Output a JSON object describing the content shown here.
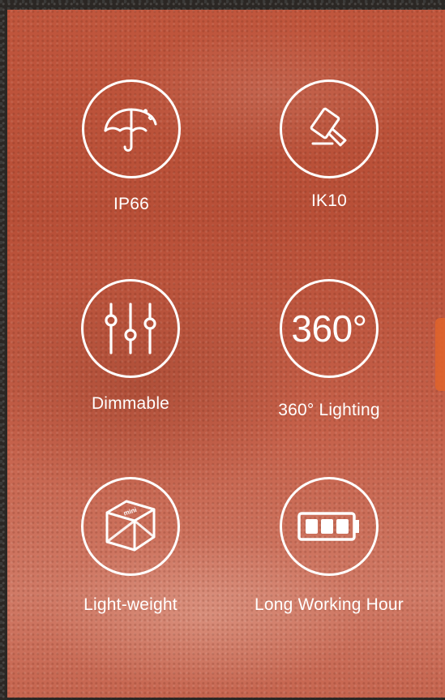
{
  "features": [
    {
      "label": "IP66",
      "icon": "umbrella-icon"
    },
    {
      "label": "IK10",
      "icon": "hammer-icon"
    },
    {
      "label": "Dimmable",
      "icon": "sliders-icon"
    },
    {
      "label": "360° Lighting",
      "icon_text": "360°",
      "icon": "360-icon"
    },
    {
      "label": "Light-weight",
      "icon": "cube-icon",
      "icon_text": "mini"
    },
    {
      "label": "Long Working Hour",
      "icon": "battery-icon"
    }
  ],
  "colors": {
    "overlay": "#c0563d",
    "icon_stroke": "#ffffff",
    "text": "#ffffff"
  }
}
